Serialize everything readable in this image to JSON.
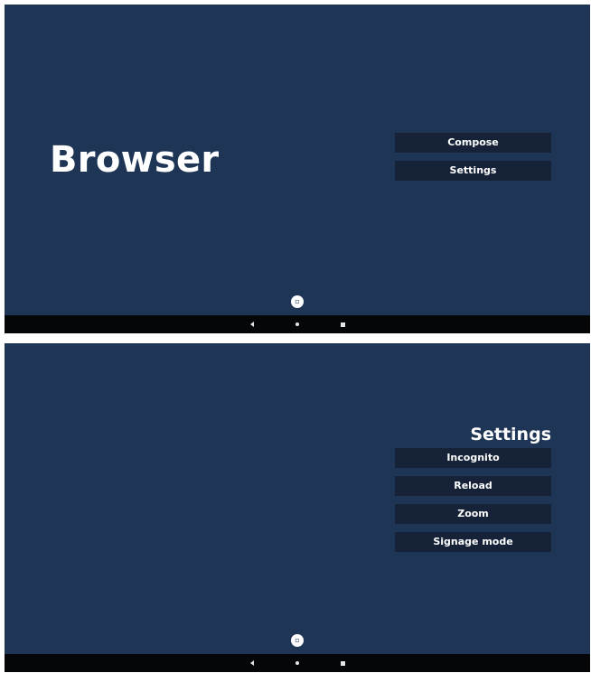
{
  "screens": [
    {
      "app_title": "Browser",
      "menu": [
        {
          "label": "Compose"
        },
        {
          "label": "Settings"
        }
      ]
    },
    {
      "heading": "Settings",
      "menu": [
        {
          "label": "Incognito"
        },
        {
          "label": "Reload"
        },
        {
          "label": "Zoom"
        },
        {
          "label": "Signage mode"
        }
      ]
    }
  ],
  "icons": {
    "home_indicator": "home-indicator-icon",
    "nav_back": "back-triangle-icon",
    "nav_home": "home-dot-icon",
    "nav_recent": "recent-apps-square-icon"
  },
  "colors": {
    "background": "#1f3556",
    "menu_button": "#152238",
    "nav_bar": "#050608",
    "text": "#ffffff"
  }
}
